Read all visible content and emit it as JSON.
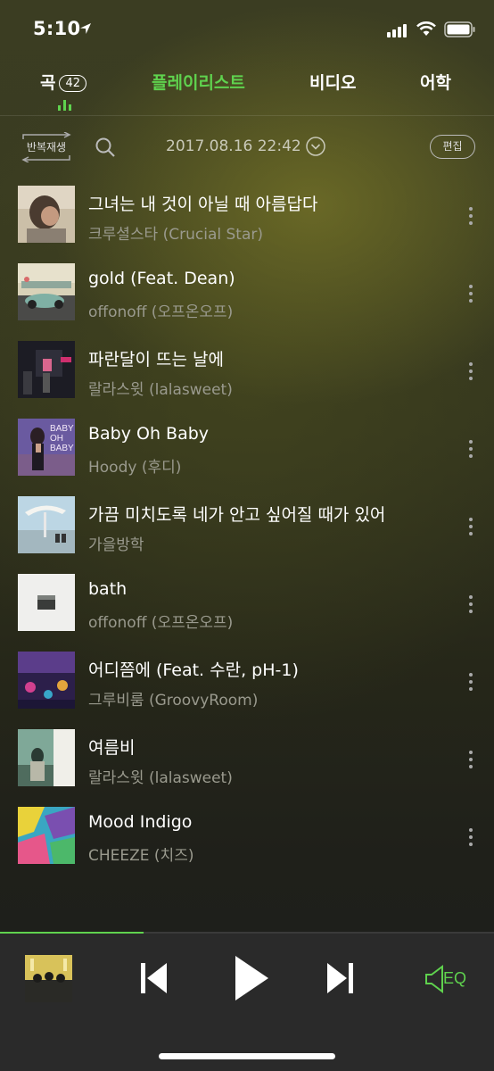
{
  "status_bar": {
    "time": "5:10"
  },
  "tabs": {
    "songs_label": "곡",
    "songs_count": "42",
    "playlist_label": "플레이리스트",
    "video_label": "비디오",
    "lang_label": "어학",
    "active": "playlist"
  },
  "toolbar": {
    "repeat_label": "반복재생",
    "date": "2017.08.16 22:42",
    "edit_label": "편집"
  },
  "songs": [
    {
      "title": "그녀는 내 것이 아닐 때 아름답다",
      "artist": "크루셜스타 (Crucial Star)"
    },
    {
      "title": "gold (Feat. Dean)",
      "artist": "offonoff (오프온오프)"
    },
    {
      "title": "파란달이 뜨는 날에",
      "artist": "랄라스윗 (lalasweet)"
    },
    {
      "title": "Baby Oh Baby",
      "artist": "Hoody (후디)"
    },
    {
      "title": "가끔 미치도록 네가 안고 싶어질 때가 있어",
      "artist": "가을방학"
    },
    {
      "title": "bath",
      "artist": "offonoff (오프온오프)"
    },
    {
      "title": "어디쯤에 (Feat. 수란, pH-1)",
      "artist": "그루비룸 (GroovyRoom)"
    },
    {
      "title": "여름비",
      "artist": "랄라스윗 (lalasweet)"
    },
    {
      "title": "Mood Indigo",
      "artist": "CHEEZE (치즈)"
    }
  ],
  "album_art_text": {
    "baby_oh_baby": "BABY OH BABY"
  },
  "player": {
    "progress_fraction": 0.29,
    "eq_label": "EQ",
    "accent_color": "#5fd24e"
  }
}
